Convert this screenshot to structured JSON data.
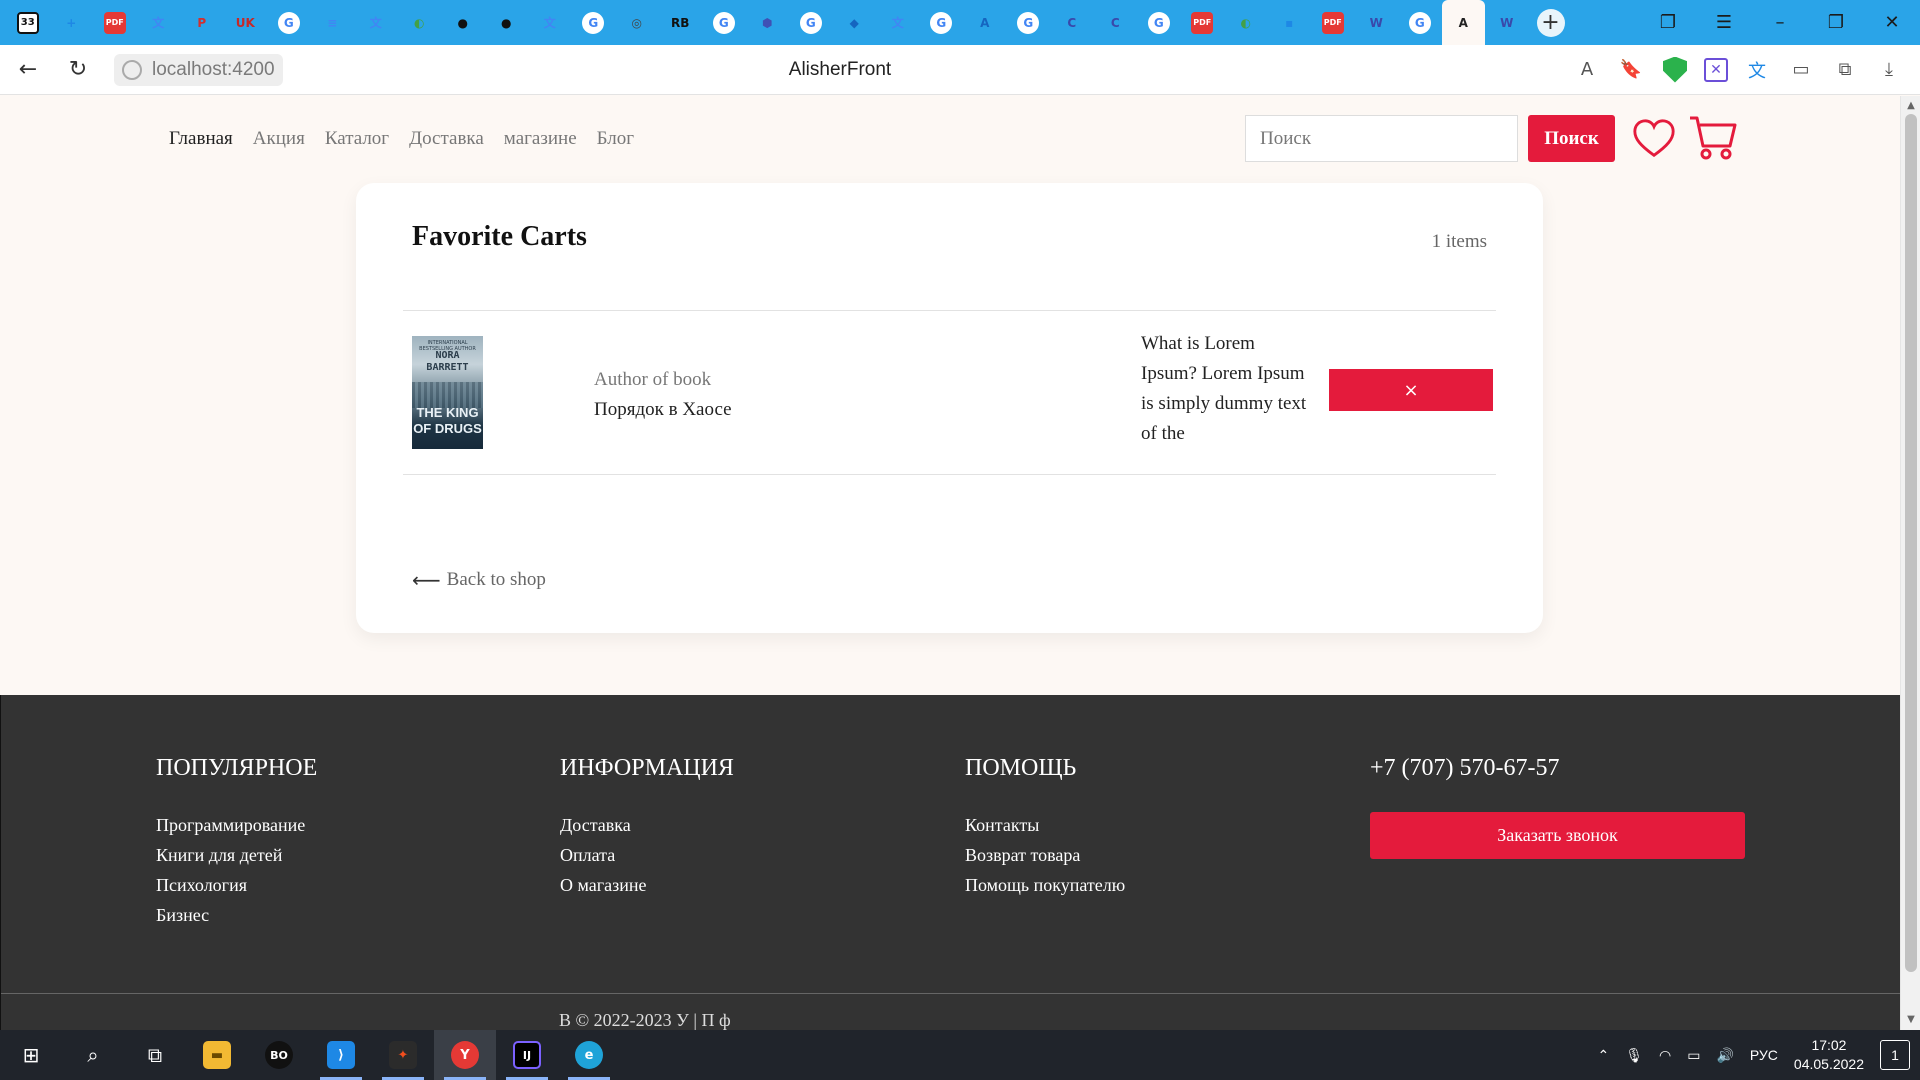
{
  "browser": {
    "tab_count_badge": "33",
    "tab_icons": [
      {
        "name": "tabs-overview-icon",
        "glyph": "33",
        "color": "#ffffff"
      },
      {
        "name": "new-tab-bookmark-icon",
        "glyph": "+",
        "color": "#1e88e5"
      },
      {
        "name": "pdf-icon",
        "glyph": "PDF",
        "color": "#e53935"
      },
      {
        "name": "translate-icon",
        "glyph": "文",
        "color": "#4285f4"
      },
      {
        "name": "p-app-icon",
        "glyph": "P",
        "color": "#d32f2f"
      },
      {
        "name": "uk-icon",
        "glyph": "UK",
        "color": "#c62828"
      },
      {
        "name": "google-icon",
        "glyph": "G",
        "color": "#ffffff"
      },
      {
        "name": "docs-icon",
        "glyph": "≡",
        "color": "#4285f4"
      },
      {
        "name": "translate-icon",
        "glyph": "文",
        "color": "#4285f4"
      },
      {
        "name": "app-icon",
        "glyph": "◐",
        "color": "#43a047"
      },
      {
        "name": "github-icon",
        "glyph": "●",
        "color": "#111111"
      },
      {
        "name": "github-icon",
        "glyph": "●",
        "color": "#111111"
      },
      {
        "name": "translate-icon",
        "glyph": "文",
        "color": "#4285f4"
      },
      {
        "name": "google-icon",
        "glyph": "G",
        "color": "#ffffff"
      },
      {
        "name": "circle-app-icon",
        "glyph": "◎",
        "color": "#444444"
      },
      {
        "name": "rb-icon",
        "glyph": "RB",
        "color": "#111111"
      },
      {
        "name": "google-icon",
        "glyph": "G",
        "color": "#ffffff"
      },
      {
        "name": "hex-app-icon",
        "glyph": "⬢",
        "color": "#3f51b5"
      },
      {
        "name": "google-icon",
        "glyph": "G",
        "color": "#ffffff"
      },
      {
        "name": "app-icon",
        "glyph": "◆",
        "color": "#1565c0"
      },
      {
        "name": "translate-icon",
        "glyph": "文",
        "color": "#4285f4"
      },
      {
        "name": "google-icon",
        "glyph": "G",
        "color": "#ffffff"
      },
      {
        "name": "azure-icon",
        "glyph": "A",
        "color": "#1565c0"
      },
      {
        "name": "google-icon",
        "glyph": "G",
        "color": "#ffffff"
      },
      {
        "name": "c-app-icon",
        "glyph": "C",
        "color": "#3949ab"
      },
      {
        "name": "c-app-icon",
        "glyph": "C",
        "color": "#3949ab"
      },
      {
        "name": "google-icon",
        "glyph": "G",
        "color": "#ffffff"
      },
      {
        "name": "pdf-icon",
        "glyph": "PDF",
        "color": "#e53935"
      },
      {
        "name": "app-icon",
        "glyph": "◐",
        "color": "#43a047"
      },
      {
        "name": "doc-icon",
        "glyph": "▪",
        "color": "#1e88e5"
      },
      {
        "name": "pdf-icon",
        "glyph": "PDF",
        "color": "#e53935"
      },
      {
        "name": "app-icon",
        "glyph": "W",
        "color": "#3949ab"
      },
      {
        "name": "google-icon",
        "glyph": "G",
        "color": "#ffffff"
      },
      {
        "name": "angular-icon",
        "glyph": "A",
        "color": "#222222"
      },
      {
        "name": "app-icon",
        "glyph": "W",
        "color": "#3949ab"
      }
    ],
    "active_tab_index": 33,
    "url": "localhost:4200",
    "page_title": "AlisherFront"
  },
  "nav": {
    "items": [
      "Главная",
      "Акция",
      "Каталог",
      "Доставка",
      "магазине",
      "Блог"
    ],
    "search_placeholder": "Поиск",
    "search_button": "Поиск"
  },
  "favorites": {
    "title": "Favorite Carts",
    "count": "1 items",
    "items": [
      {
        "cover_top": "INTERNATIONAL BESTSELLING AUTHOR",
        "cover_author": "NORA BARRETT",
        "cover_title": "THE KING OF DRUGS",
        "author_label": "Author of book",
        "book_name": "Порядок в Хаосе",
        "description": "What is Lorem Ipsum? Lorem Ipsum is simply dummy text of the",
        "remove_label": "×"
      }
    ],
    "back_link": "Back to shop"
  },
  "footer": {
    "popular": {
      "title": "ПОПУЛЯРНОЕ",
      "links": [
        "Программирование",
        "Книги для детей",
        "Психология",
        "Бизнес"
      ]
    },
    "info": {
      "title": "ИНФОРМАЦИЯ",
      "links": [
        "Доставка",
        "Оплата",
        "О магазине"
      ]
    },
    "help": {
      "title": "ПОМОЩЬ",
      "links": [
        "Контакты",
        "Возврат товара",
        "Помощь покупателю"
      ]
    },
    "phone": "+7 (707) 570-67-57",
    "call_button": "Заказать звонок",
    "bottom_text": "В                    © 2022-2023 У                              | П                 ф"
  },
  "taskbar": {
    "language": "РУС",
    "time": "17:02",
    "date": "04.05.2022",
    "notifications": "1"
  },
  "colors": {
    "accent": "#e41b3c",
    "footer_bg": "#333333",
    "page_bg": "#fdf8f4",
    "tab_strip": "#2aa4e8"
  }
}
